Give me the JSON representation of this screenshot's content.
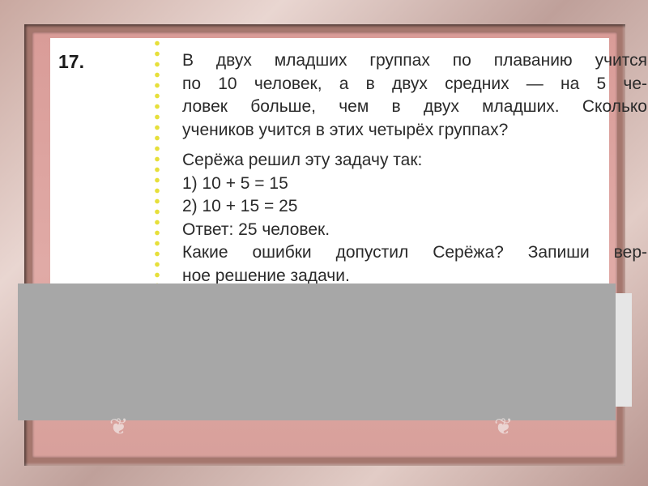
{
  "problem": {
    "number": "17.",
    "lines": [
      "В двух младших группах по плаванию учится",
      "по 10 человек, а в двух средних — на 5 че-",
      "ловек больше, чем в двух младших. Сколько",
      "учеников учится в этих четырёх группах?"
    ],
    "solution_intro": "Серёжа решил эту задачу так:",
    "steps": [
      "1) 10 + 5 = 15",
      "2) 10 + 15 = 25"
    ],
    "answer": "Ответ: 25 человек.",
    "question_lines": [
      "Какие ошибки допустил Серёжа? Запиши вер-",
      "ное решение задачи."
    ]
  },
  "colors": {
    "frame_pink": "#d99c98",
    "page": "#ffffff",
    "dots": "#e6df3a",
    "overlay_gray": "#a7a7a7"
  }
}
